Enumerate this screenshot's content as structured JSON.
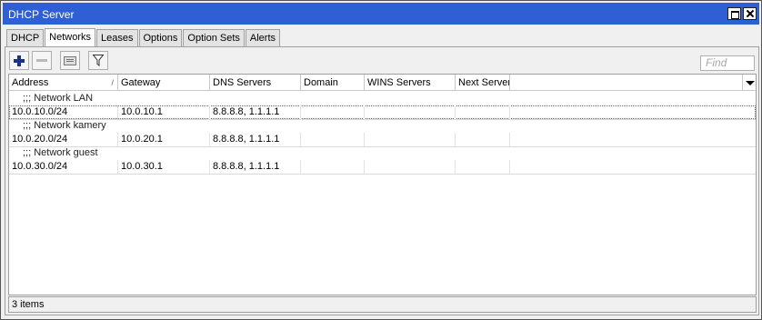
{
  "window": {
    "title": "DHCP Server"
  },
  "tabs": [
    {
      "label": "DHCP"
    },
    {
      "label": "Networks",
      "active": true
    },
    {
      "label": "Leases"
    },
    {
      "label": "Options"
    },
    {
      "label": "Option Sets"
    },
    {
      "label": "Alerts"
    }
  ],
  "toolbar": {
    "add_icon": "plus-icon",
    "remove_icon": "minus-icon",
    "comment_icon": "comment-icon",
    "filter_icon": "filter-icon"
  },
  "search": {
    "placeholder": "Find"
  },
  "table": {
    "columns": [
      "Address",
      "Gateway",
      "DNS Servers",
      "Domain",
      "WINS Servers",
      "Next Server"
    ],
    "sort_indicator": "/",
    "rows": [
      {
        "comment": ";;; Network LAN",
        "address": "10.0.10.0/24",
        "gateway": "10.0.10.1",
        "dns": "8.8.8.8, 1.1.1.1",
        "domain": "",
        "wins": "",
        "next_server": ""
      },
      {
        "comment": ";;; Network kamery",
        "address": "10.0.20.0/24",
        "gateway": "10.0.20.1",
        "dns": "8.8.8.8, 1.1.1.1",
        "domain": "",
        "wins": "",
        "next_server": ""
      },
      {
        "comment": ";;; Network guest",
        "address": "10.0.30.0/24",
        "gateway": "10.0.30.1",
        "dns": "8.8.8.8, 1.1.1.1",
        "domain": "",
        "wins": "",
        "next_server": ""
      }
    ]
  },
  "status": {
    "text": "3 items"
  },
  "colors": {
    "titlebar": "#2f5fd5",
    "add_icon": "#1b2f8c"
  }
}
